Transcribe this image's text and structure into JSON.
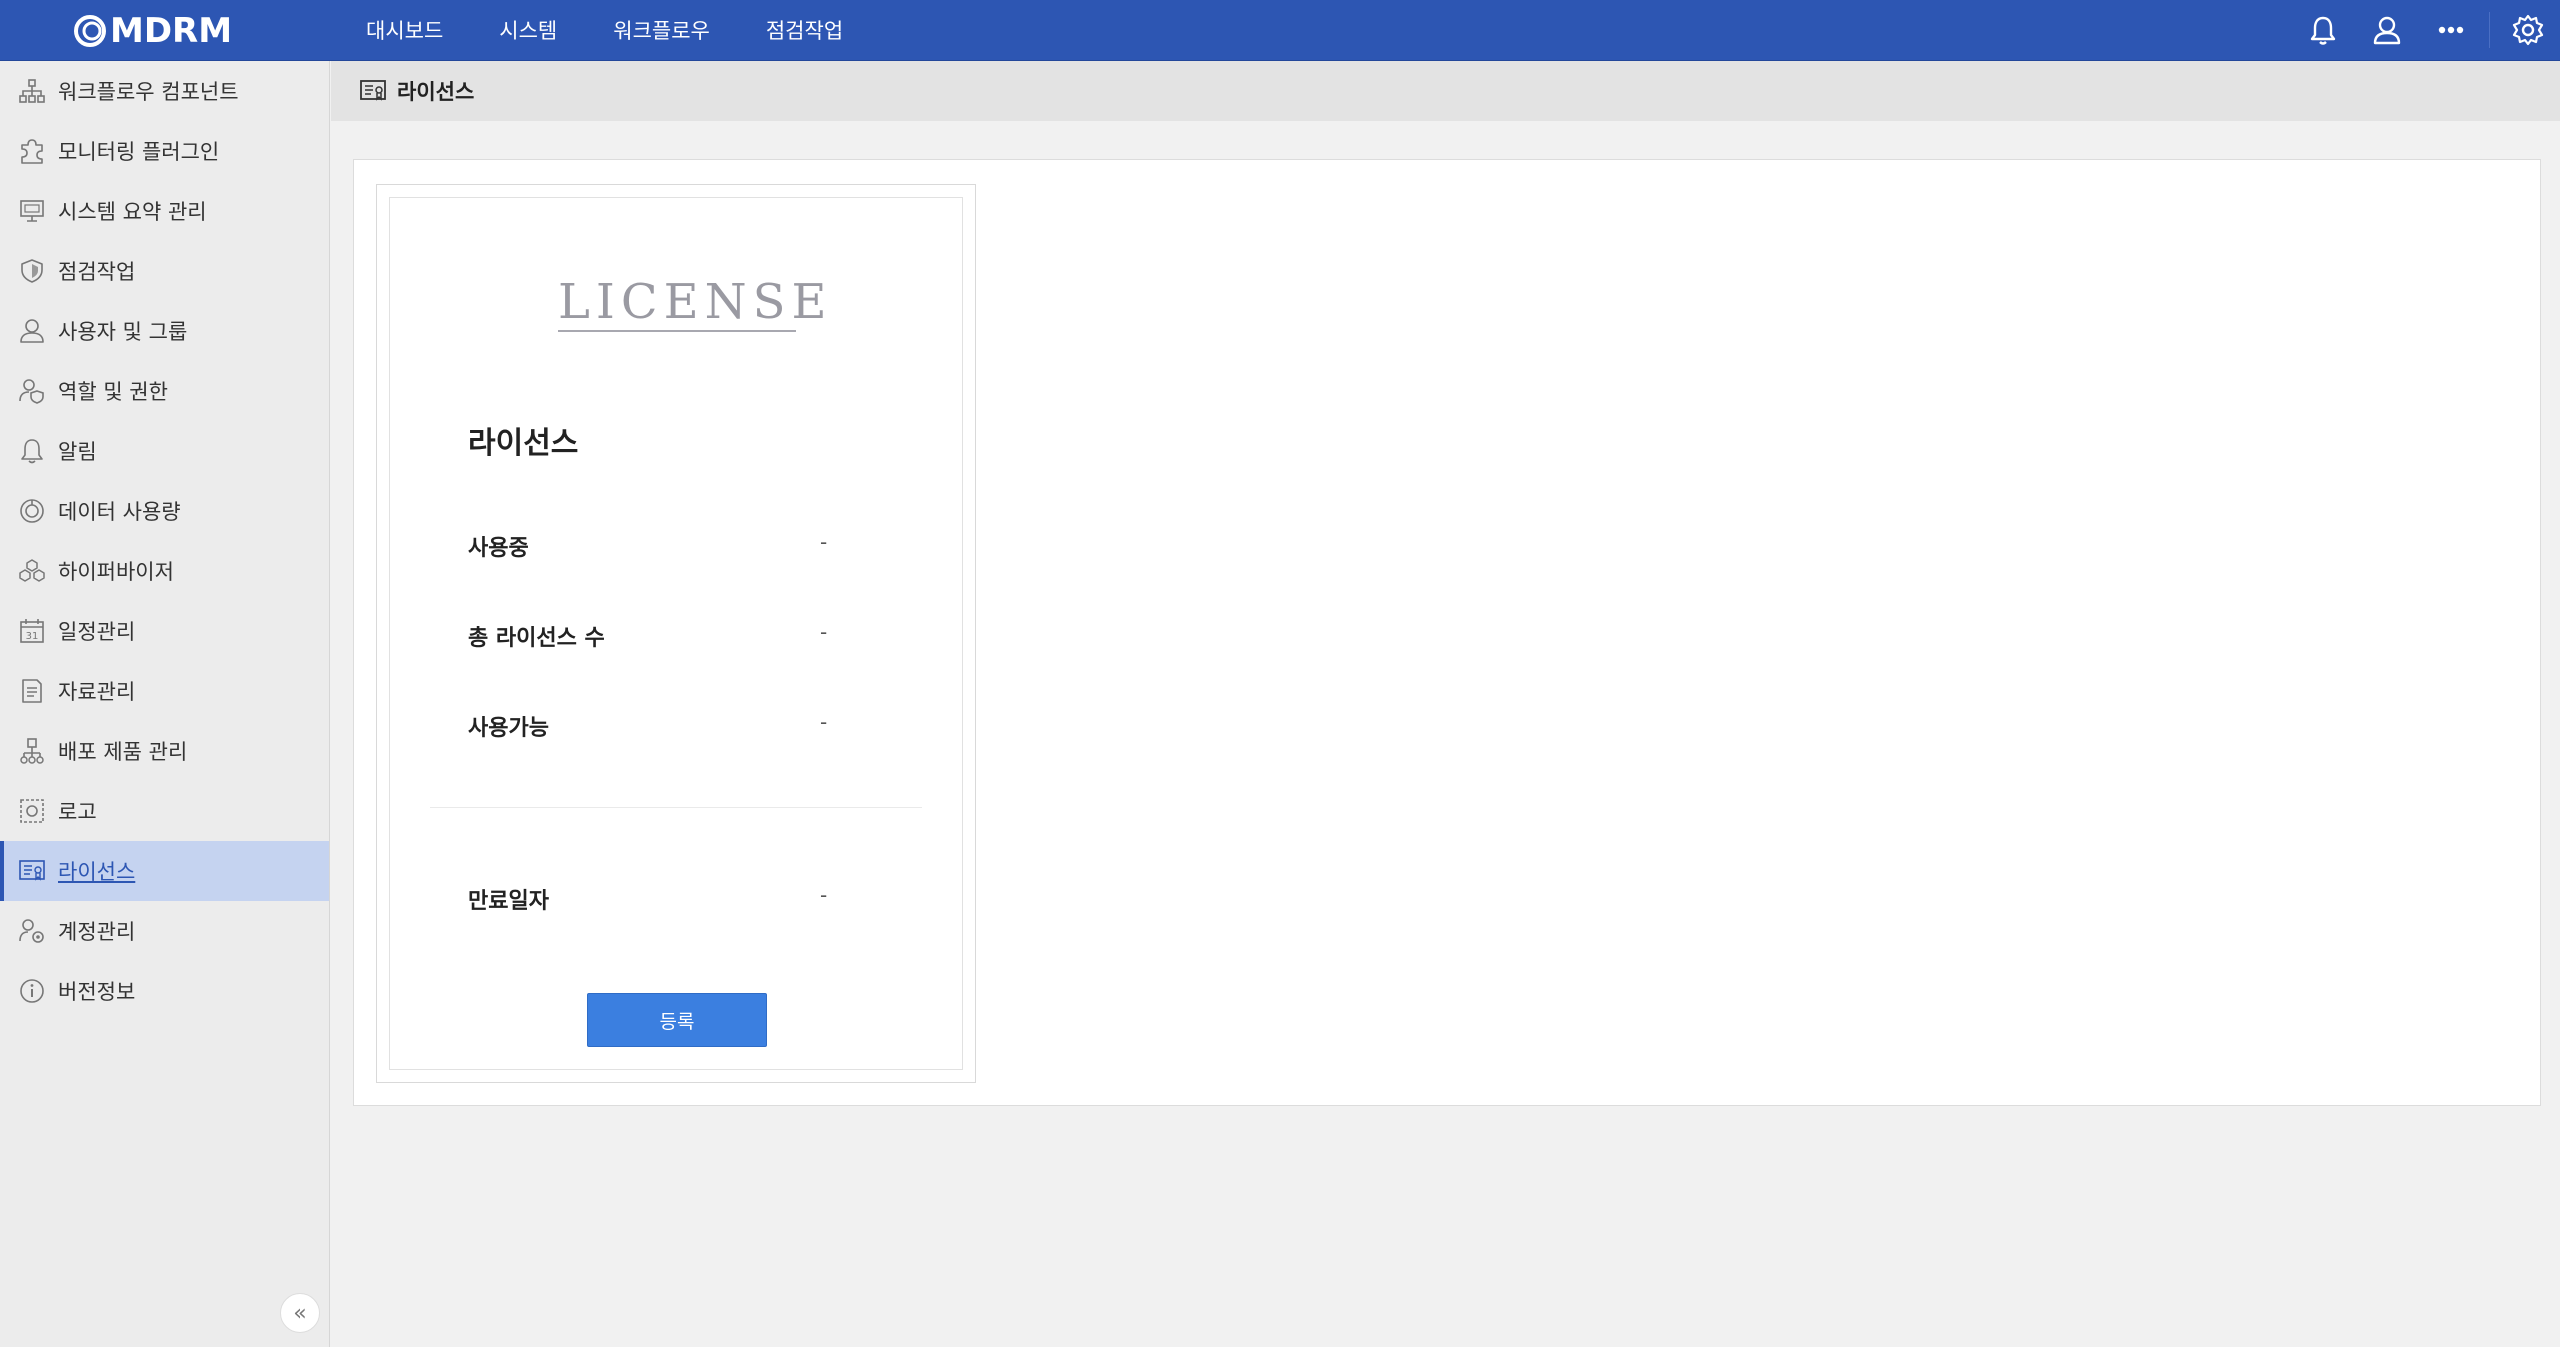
{
  "app": {
    "logo_text": "MDRM"
  },
  "topnav": [
    {
      "label": "대시보드"
    },
    {
      "label": "시스템"
    },
    {
      "label": "워크플로우"
    },
    {
      "label": "점검작업"
    }
  ],
  "sidebar": {
    "items": [
      {
        "label": "워크플로우 컴포넌트",
        "icon": "hierarchy-icon"
      },
      {
        "label": "모니터링 플러그인",
        "icon": "puzzle-icon"
      },
      {
        "label": "시스템 요약 관리",
        "icon": "monitor-icon"
      },
      {
        "label": "점검작업",
        "icon": "shield-icon"
      },
      {
        "label": "사용자 및 그룹",
        "icon": "user-icon"
      },
      {
        "label": "역할 및 권한",
        "icon": "user-shield-icon"
      },
      {
        "label": "알림",
        "icon": "bell-icon"
      },
      {
        "label": "데이터 사용량",
        "icon": "pie-icon"
      },
      {
        "label": "하이퍼바이저",
        "icon": "cubes-icon"
      },
      {
        "label": "일정관리",
        "icon": "calendar-icon"
      },
      {
        "label": "자료관리",
        "icon": "document-icon"
      },
      {
        "label": "배포 제품 관리",
        "icon": "deploy-icon"
      },
      {
        "label": "로고",
        "icon": "logo-frame-icon"
      },
      {
        "label": "라이선스",
        "icon": "license-icon"
      },
      {
        "label": "계정관리",
        "icon": "user-gear-icon"
      },
      {
        "label": "버전정보",
        "icon": "info-icon"
      }
    ],
    "active_index": 13,
    "collapse_glyph": "«"
  },
  "header": {
    "title": "라이선스"
  },
  "license_card": {
    "logo_word": "LICENSE",
    "title": "라이선스",
    "rows": [
      {
        "label": "사용중",
        "value": "-"
      },
      {
        "label": "총 라이선스 수",
        "value": "-"
      },
      {
        "label": "사용가능",
        "value": "-"
      }
    ],
    "expiry": {
      "label": "만료일자",
      "value": "-"
    },
    "register_button": "등록"
  },
  "colors": {
    "accent": "#2d56b3",
    "button": "#3b7fe0",
    "active_bg": "#c5d3f0"
  }
}
